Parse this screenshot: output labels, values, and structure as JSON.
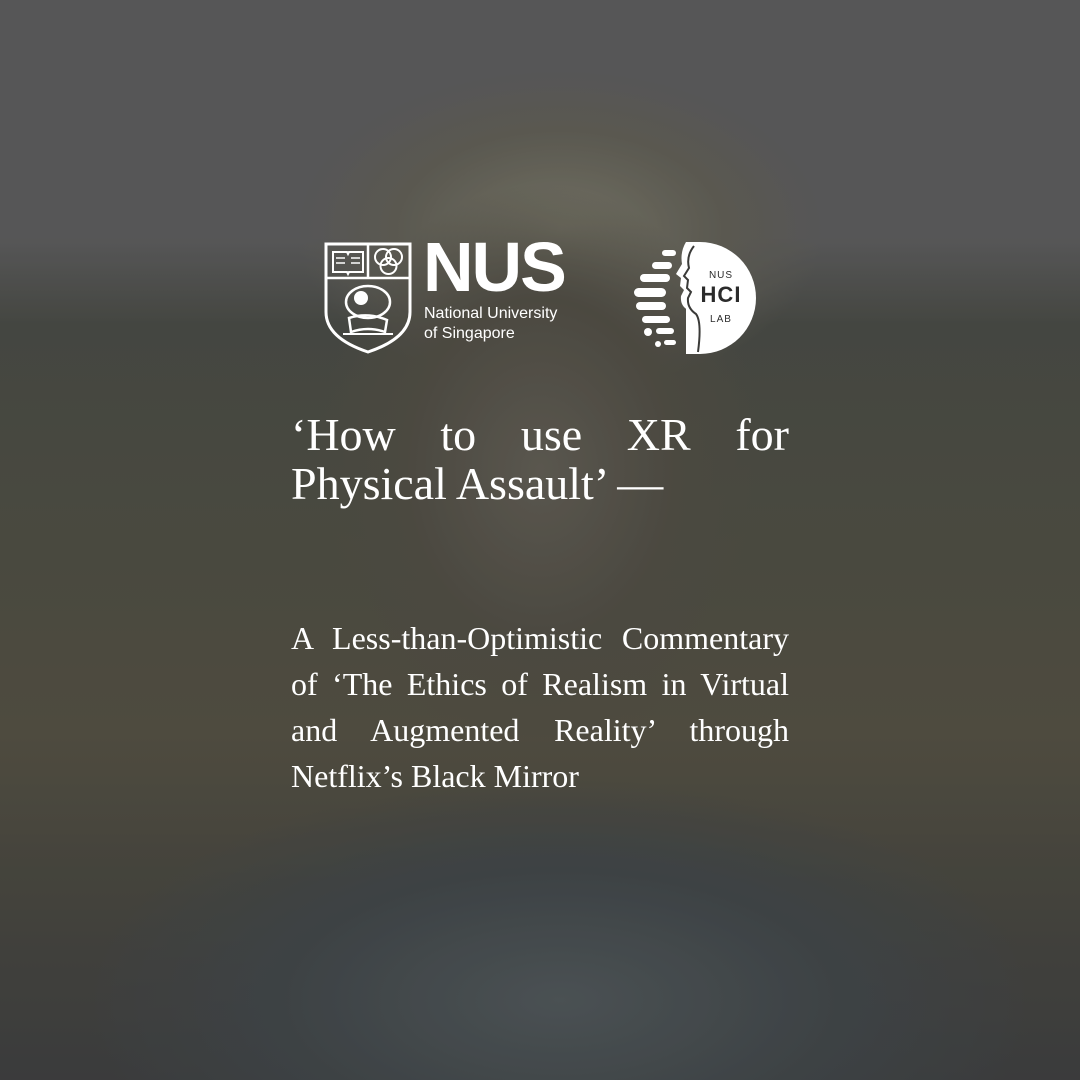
{
  "nus_logo": {
    "wordmark": "NUS",
    "line1": "National University",
    "line2": "of Singapore"
  },
  "hci_logo": {
    "top": "NUS",
    "middle": "HCI",
    "bottom": "LAB"
  },
  "title": "‘How to use XR for Physical Assault’ —",
  "subtitle": "A Less-than-Optimistic Commentary of ‘The Ethics of Realism in Virtual and Augmented Reality’ through Netflix’s Black Mirror",
  "colors": {
    "text": "#ffffff",
    "overlay": "#3a3a38"
  }
}
